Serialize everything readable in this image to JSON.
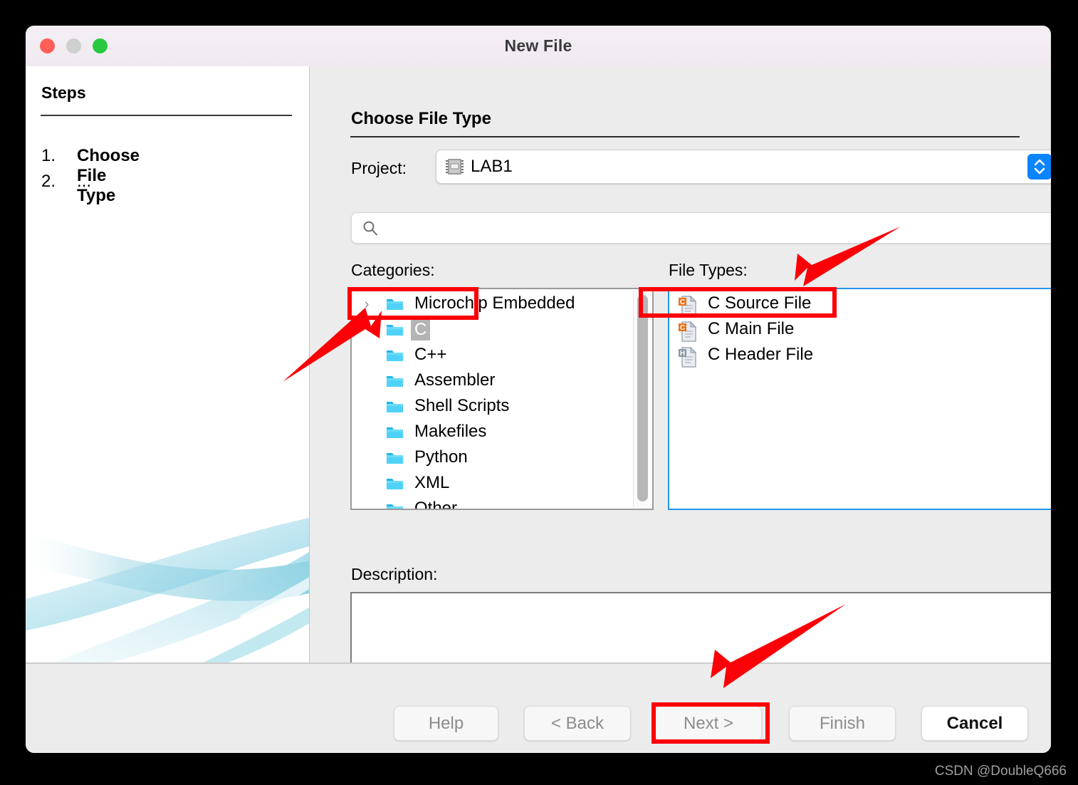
{
  "window": {
    "title": "New File",
    "traffic_lights": [
      "close-red",
      "minimize-gray",
      "zoom-green"
    ]
  },
  "sidebar": {
    "heading": "Steps",
    "steps": [
      {
        "num": "1.",
        "label": "Choose File Type"
      },
      {
        "num": "2.",
        "label": "..."
      }
    ]
  },
  "main": {
    "section_title": "Choose File Type",
    "project": {
      "label": "Project:",
      "value": "LAB1",
      "icon": "chip-icon",
      "stepper_icon": "up-down-chevron-icon"
    },
    "search": {
      "placeholder": "",
      "value": "",
      "icon": "search-icon"
    },
    "categories": {
      "label": "Categories:",
      "items": [
        {
          "label": "Microchip Embedded",
          "expandable": true,
          "selected": false
        },
        {
          "label": "C",
          "expandable": false,
          "selected": true
        },
        {
          "label": "C++",
          "expandable": false,
          "selected": false
        },
        {
          "label": "Assembler",
          "expandable": false,
          "selected": false
        },
        {
          "label": "Shell Scripts",
          "expandable": false,
          "selected": false
        },
        {
          "label": "Makefiles",
          "expandable": false,
          "selected": false
        },
        {
          "label": "Python",
          "expandable": false,
          "selected": false
        },
        {
          "label": "XML",
          "expandable": false,
          "selected": false
        },
        {
          "label": "Other",
          "expandable": false,
          "selected": false
        }
      ]
    },
    "file_types": {
      "label": "File Types:",
      "items": [
        {
          "label": "C Source File",
          "icon": "c-file-icon"
        },
        {
          "label": "C Main File",
          "icon": "c-file-icon"
        },
        {
          "label": "C Header File",
          "icon": "h-file-icon"
        }
      ]
    },
    "description": {
      "label": "Description:",
      "value": ""
    }
  },
  "footer": {
    "buttons": [
      {
        "label": "Help",
        "enabled": false
      },
      {
        "label": "< Back",
        "enabled": false
      },
      {
        "label": "Next >",
        "enabled": false,
        "highlighted": true
      },
      {
        "label": "Finish",
        "enabled": false
      },
      {
        "label": "Cancel",
        "enabled": true
      }
    ]
  },
  "annotations": {
    "highlight_boxes": [
      {
        "target": "categories-item-c"
      },
      {
        "target": "file-type-c-main-file"
      },
      {
        "target": "next-button"
      }
    ],
    "arrows": [
      {
        "points_to": "categories-item-c"
      },
      {
        "points_to": "file-type-c-main-file"
      },
      {
        "points_to": "next-button"
      }
    ],
    "accent_color": "#fb0007"
  },
  "watermark": "CSDN @DoubleQ666"
}
